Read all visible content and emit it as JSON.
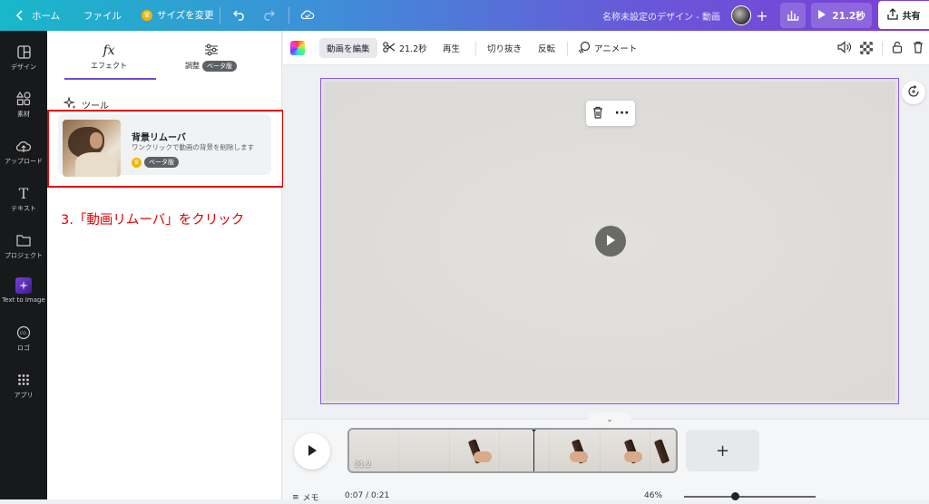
{
  "topbar": {
    "home": "ホーム",
    "file": "ファイル",
    "resize": "サイズを変更",
    "title": "名称未設定のデザイン - 動画",
    "play_duration": "21.2秒",
    "share": "共有"
  },
  "leftnav": {
    "items": [
      {
        "label": "デザイン",
        "icon": "layout-icon"
      },
      {
        "label": "素材",
        "icon": "shapes-icon"
      },
      {
        "label": "アップロード",
        "icon": "upload-cloud-icon"
      },
      {
        "label": "テキスト",
        "icon": "text-icon"
      },
      {
        "label": "プロジェクト",
        "icon": "folder-icon"
      },
      {
        "label": "Text to Image",
        "icon": "ai-image-icon"
      },
      {
        "label": "ロゴ",
        "icon": "logo-icon"
      },
      {
        "label": "アプリ",
        "icon": "apps-grid-icon"
      }
    ]
  },
  "panel": {
    "tab_effects": "エフェクト",
    "tab_adjust": "調整",
    "beta": "ベータ版",
    "tools_label": "ツール",
    "card": {
      "title": "背景リムーバ",
      "description": "ワンクリックで動画の背景を削除します",
      "badge": "ベータ版"
    },
    "instruction": "3.「動画リムーバ」をクリック"
  },
  "toolbar": {
    "edit_video": "動画を編集",
    "duration": "21.2秒",
    "playback": "再生",
    "crop": "切り抜き",
    "flip": "反転",
    "animate": "アニメート"
  },
  "timeline": {
    "clip_duration": "21.2",
    "notes": "メモ",
    "time": "0:07 / 0:21",
    "zoom": "46%"
  },
  "colors": {
    "accent": "#8a5cf0",
    "annotation_red": "#e40000"
  }
}
